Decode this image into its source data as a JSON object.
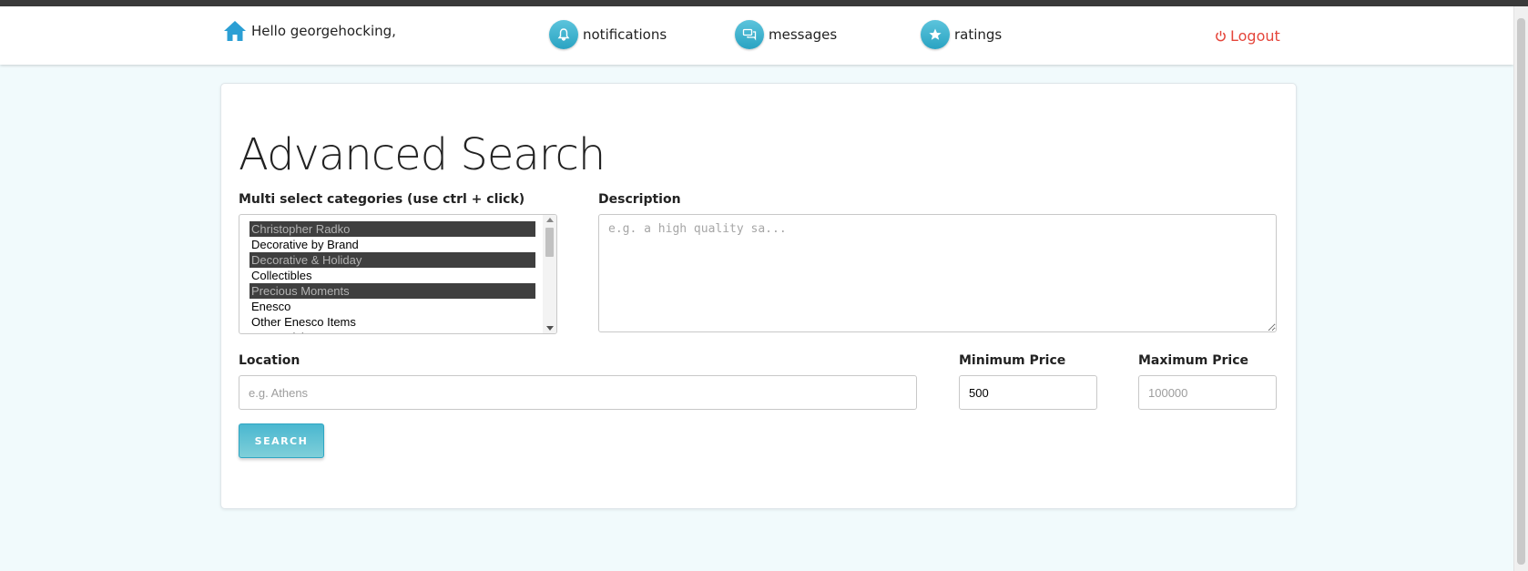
{
  "navbar": {
    "greeting": "Hello georgehocking,",
    "notifications_label": "notifications",
    "messages_label": "messages",
    "ratings_label": "ratings",
    "logout_label": "Logout",
    "accent_color": "#2aa3c2",
    "logout_color": "#e5463b"
  },
  "icons": {
    "home": "home-icon",
    "notifications": "bell-icon",
    "messages": "chat-bubbles-icon",
    "ratings": "star-icon",
    "logout": "power-icon"
  },
  "page": {
    "title": "Advanced Search"
  },
  "form": {
    "categories_label": "Multi select categories (use ctrl + click)",
    "categories": [
      {
        "label": "Christopher Radko",
        "selected": true
      },
      {
        "label": "Decorative by Brand",
        "selected": false
      },
      {
        "label": "Decorative & Holiday",
        "selected": true
      },
      {
        "label": "Collectibles",
        "selected": false
      },
      {
        "label": "Precious Moments",
        "selected": true
      },
      {
        "label": "Enesco",
        "selected": false
      },
      {
        "label": "Other Enesco Items",
        "selected": false
      },
      {
        "label": "Dreamsicles",
        "selected": false
      }
    ],
    "description_label": "Description",
    "description_placeholder": "e.g. a high quality sa...",
    "location_label": "Location",
    "location_placeholder": "e.g. Athens",
    "min_price_label": "Minimum Price",
    "min_price_value": "500",
    "max_price_label": "Maximum Price",
    "max_price_placeholder": "100000",
    "search_button": "SEARCH"
  }
}
